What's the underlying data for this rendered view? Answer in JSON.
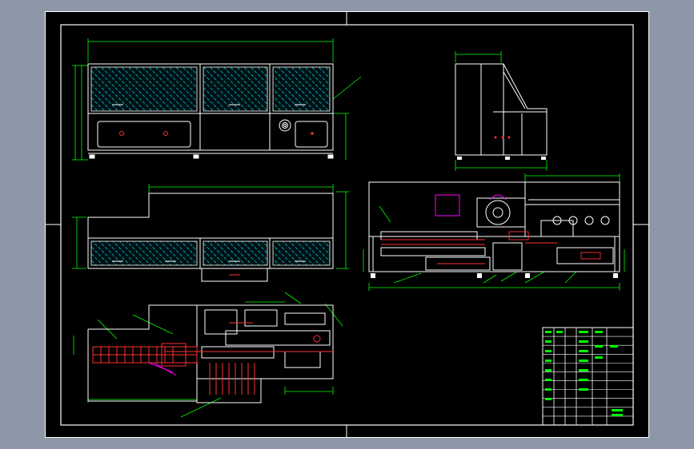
{
  "colors": {
    "background": "#8e97a8",
    "canvas": "#000000",
    "frame": "#ffffff",
    "dimension": "#00ff00",
    "hatch": "#00cccc",
    "parts": "#ff3030",
    "accent": "#ff00ff"
  },
  "views": [
    {
      "id": "front-elevation",
      "kind": "front"
    },
    {
      "id": "side-elevation",
      "kind": "side"
    },
    {
      "id": "rear-elevation",
      "kind": "rear"
    },
    {
      "id": "section-view",
      "kind": "section"
    },
    {
      "id": "plan-view",
      "kind": "plan"
    }
  ],
  "title_block": {
    "rows": 11,
    "cols": 6
  }
}
